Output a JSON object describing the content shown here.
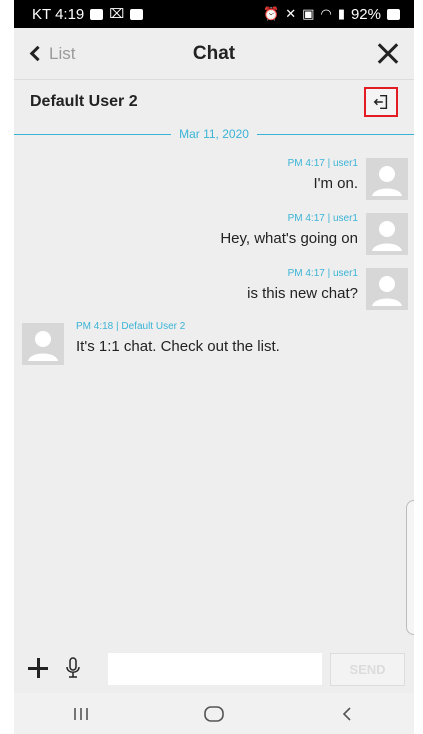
{
  "status_bar": {
    "carrier_time": "KT 4:19",
    "battery": "92%",
    "icons": [
      "gallery-icon",
      "notification-icon",
      "app-icon",
      "alarm-icon",
      "mute-icon",
      "nfc-icon",
      "wifi-icon",
      "signal-icon",
      "battery-icon"
    ]
  },
  "header": {
    "back_label": "List",
    "title": "Chat"
  },
  "room": {
    "name": "Default User 2"
  },
  "date_divider": "Mar 11, 2020",
  "messages": [
    {
      "sender": "mine",
      "meta": "PM 4:17 | user1",
      "text": "I'm on."
    },
    {
      "sender": "mine",
      "meta": "PM 4:17 | user1",
      "text": "Hey, what's going on"
    },
    {
      "sender": "mine",
      "meta": "PM 4:17 | user1",
      "text": "is this new chat?"
    },
    {
      "sender": "other",
      "meta": "PM 4:18 | Default User 2",
      "text": "It's 1:1 chat. Check out the list."
    }
  ],
  "composer": {
    "input_value": "",
    "send_label": "SEND"
  },
  "colors": {
    "accent": "#3ab4d6",
    "highlight_box": "#e31b23",
    "background": "#eeeeee"
  }
}
